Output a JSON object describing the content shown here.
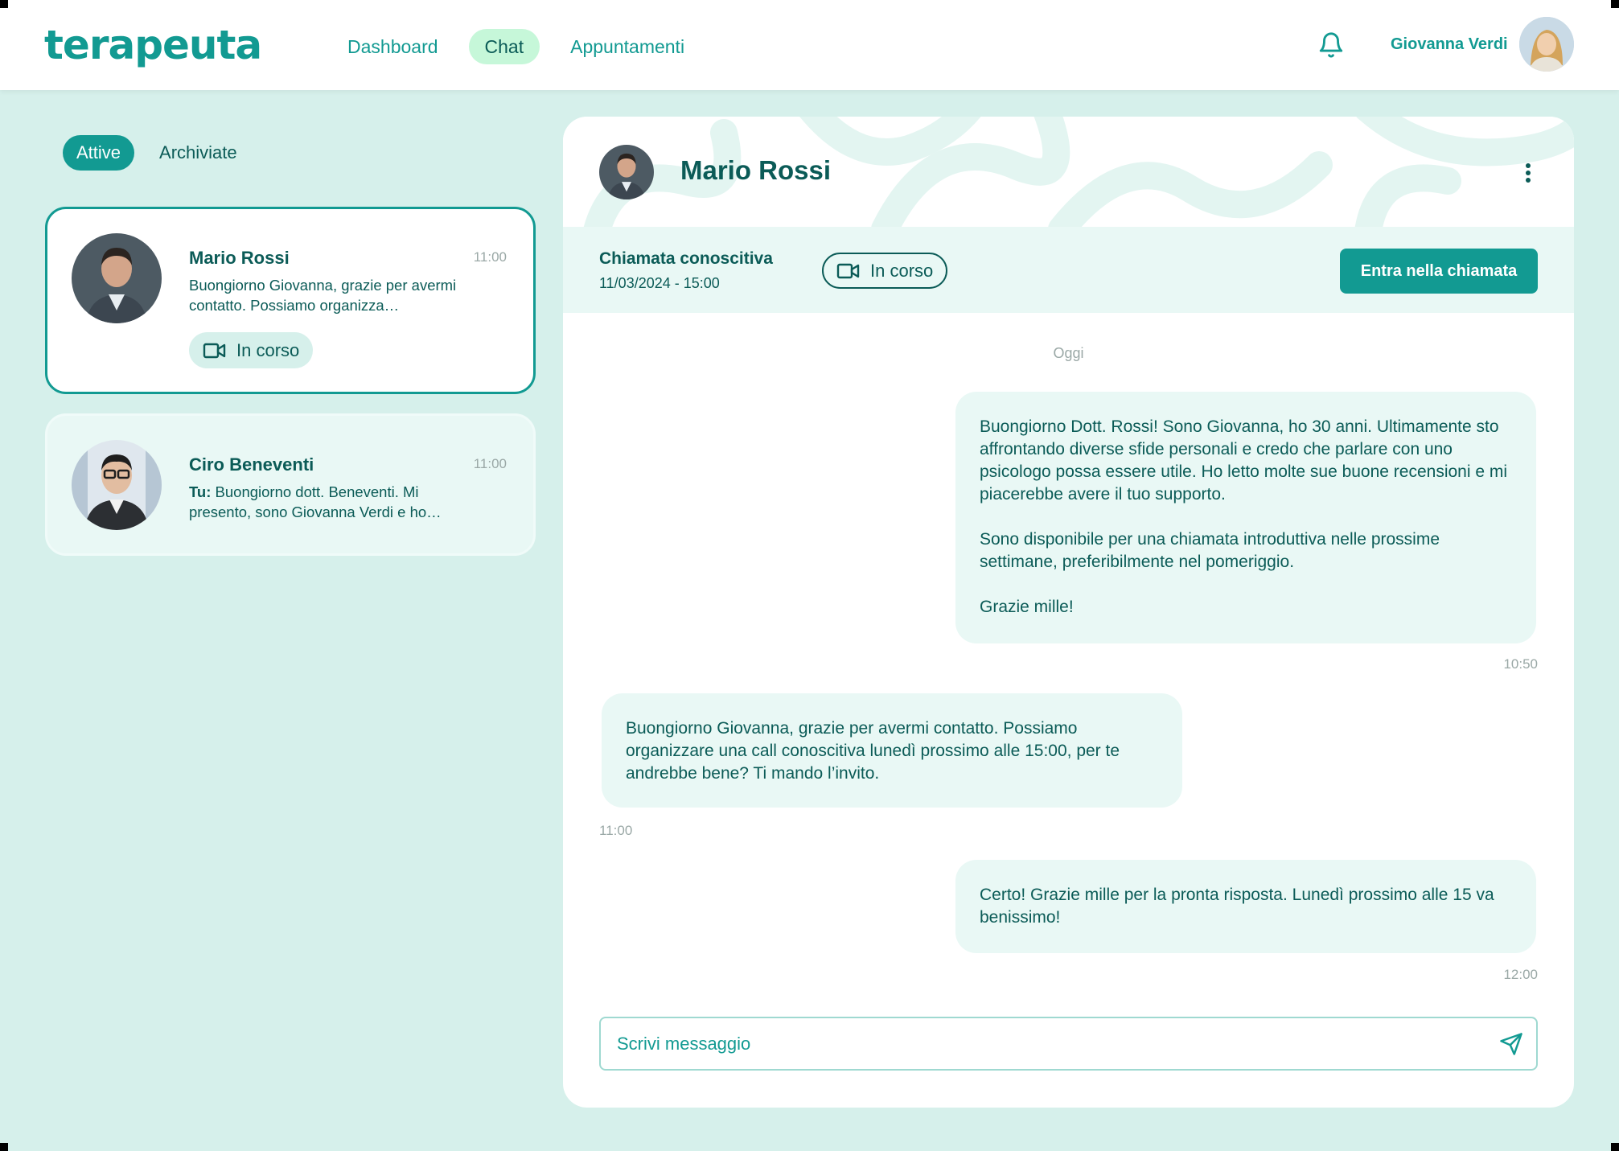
{
  "app": {
    "logo": "terapeuta"
  },
  "nav": [
    {
      "label": "Dashboard",
      "active": false
    },
    {
      "label": "Chat",
      "active": true
    },
    {
      "label": "Appuntamenti",
      "active": false
    }
  ],
  "user": {
    "name": "Giovanna Verdi"
  },
  "tabs": [
    {
      "label": "Attive",
      "active": true
    },
    {
      "label": "Archiviate",
      "active": false
    }
  ],
  "conversations": [
    {
      "name": "Mario Rossi",
      "time": "11:00",
      "preview": "Buongiorno Giovanna, grazie per avermi contatto. Possiamo organizza…",
      "status": "In corso",
      "selected": true
    },
    {
      "name": "Ciro Beneventi",
      "time": "11:00",
      "preview_prefix": "Tu:",
      "preview": "Buongiorno dott. Beneventi. Mi presento, sono Giovanna Verdi e ho…",
      "selected": false
    }
  ],
  "chat": {
    "contact_name": "Mario Rossi",
    "call": {
      "title": "Chiamata conoscitiva",
      "datetime": "11/03/2024 - 15:00",
      "status": "In corso",
      "join_label": "Entra nella chiamata"
    },
    "day_separator": "Oggi",
    "messages": [
      {
        "from": "me",
        "paragraphs": [
          "Buongiorno Dott. Rossi! Sono Giovanna, ho 30 anni. Ultimamente sto affrontando diverse sfide personali e credo che parlare con uno psicologo possa essere utile. Ho letto molte sue buone recensioni e mi piacerebbe avere il tuo supporto.",
          "Sono disponibile per una chiamata introduttiva nelle prossime settimane, preferibilmente nel pomeriggio.",
          "Grazie mille!"
        ],
        "time": "10:50"
      },
      {
        "from": "contact",
        "paragraphs": [
          "Buongiorno Giovanna, grazie per avermi contatto. Possiamo organizzare una call conoscitiva lunedì prossimo alle 15:00, per te andrebbe bene? Ti mando l’invito."
        ],
        "time": "11:00"
      },
      {
        "from": "me",
        "paragraphs": [
          "Certo! Grazie mille per la pronta risposta. Lunedì prossimo alle 15 va benissimo!"
        ],
        "time": "12:00"
      }
    ],
    "composer_placeholder": "Scrivi messaggio"
  },
  "colors": {
    "accent": "#129a92",
    "text": "#0b5b57",
    "background": "#d6f0eb",
    "bubble": "#e9f8f5",
    "nav_active": "#c6f7d9"
  },
  "icons": [
    "bell-icon",
    "video-camera-icon",
    "more-vertical-icon",
    "send-icon"
  ]
}
